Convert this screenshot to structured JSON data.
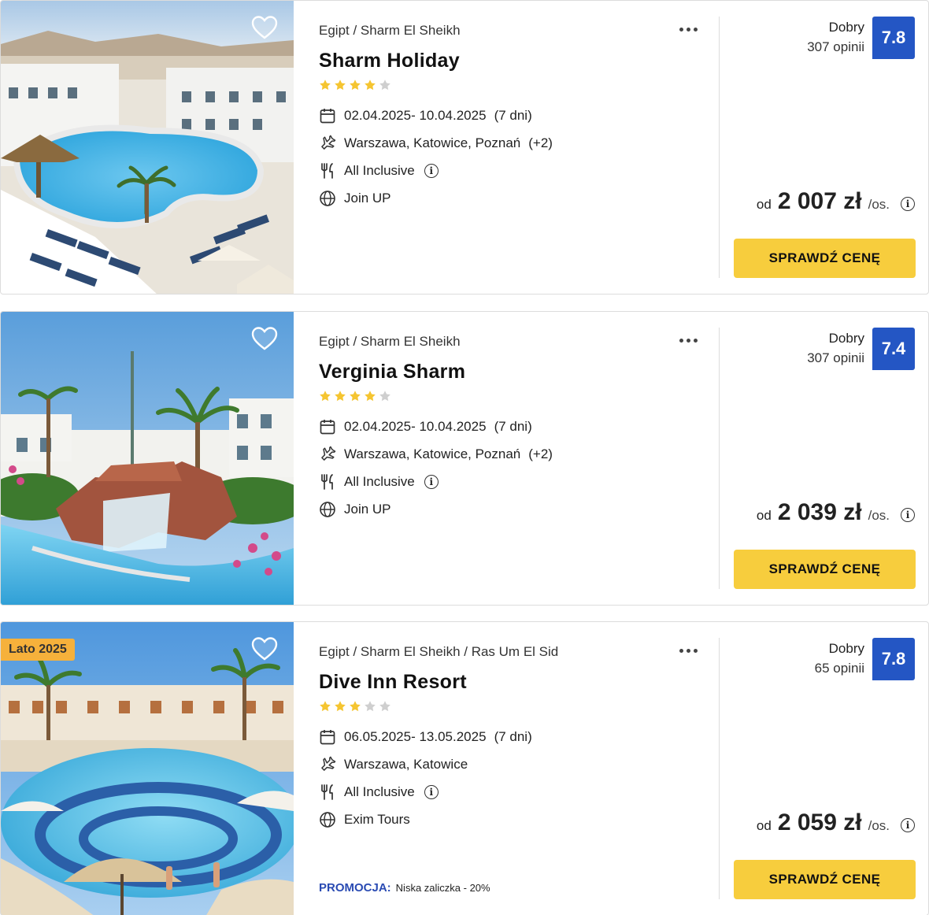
{
  "cards": [
    {
      "location": "Egipt / Sharm El Sheikh",
      "name": "Sharm Holiday",
      "stars": 4,
      "dates": "02.04.2025- 10.04.2025",
      "duration": "(7 dni)",
      "airports": "Warszawa, Katowice, Poznań",
      "airports_more": "(+2)",
      "board": "All Inclusive",
      "operator": "Join UP",
      "rating_word": "Dobry",
      "rating_count": "307 opinii",
      "rating": "7.8",
      "price_prefix": "od",
      "price": "2 007 zł",
      "price_suffix": "/os.",
      "cta": "SPRAWDŹ CENĘ"
    },
    {
      "location": "Egipt / Sharm El Sheikh",
      "name": "Verginia Sharm",
      "stars": 4,
      "dates": "02.04.2025- 10.04.2025",
      "duration": "(7 dni)",
      "airports": "Warszawa, Katowice, Poznań",
      "airports_more": "(+2)",
      "board": "All Inclusive",
      "operator": "Join UP",
      "rating_word": "Dobry",
      "rating_count": "307 opinii",
      "rating": "7.4",
      "price_prefix": "od",
      "price": "2 039 zł",
      "price_suffix": "/os.",
      "cta": "SPRAWDŹ CENĘ"
    },
    {
      "badge": "Lato 2025",
      "location": "Egipt / Sharm El Sheikh / Ras Um El Sid",
      "name": "Dive Inn Resort",
      "stars": 3,
      "dates": "06.05.2025- 13.05.2025",
      "duration": "(7 dni)",
      "airports": "Warszawa, Katowice",
      "board": "All Inclusive",
      "operator": "Exim Tours",
      "promo_label": "PROMOCJA:",
      "promo_text": "Niska zaliczka - 20%",
      "rating_word": "Dobry",
      "rating_count": "65 opinii",
      "rating": "7.8",
      "price_prefix": "od",
      "price": "2 059 zł",
      "price_suffix": "/os.",
      "cta": "SPRAWDŹ CENĘ"
    }
  ],
  "colors": {
    "rating_box": "#2456c4",
    "cta": "#f7cd3d",
    "star_on": "#f5c531",
    "star_off": "#cfcfcf",
    "promo": "#2a4bb3",
    "badge": "#f6b13b"
  },
  "icons": [
    "heart-icon",
    "more-dots-icon",
    "calendar-icon",
    "plane-icon",
    "cutlery-icon",
    "info-icon",
    "globe-icon"
  ]
}
